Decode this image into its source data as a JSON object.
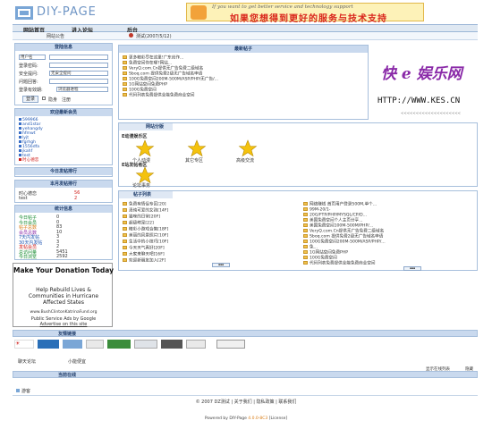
{
  "header": {
    "logo_text": "DIY-PAGE",
    "ad_line1": "If you want to get better service and technology support",
    "ad_line2": "如果您想得到更好的服务与技术支持"
  },
  "nav": {
    "items": [
      "网站首页",
      "进入论坛",
      "后台"
    ]
  },
  "subnav": {
    "notice_label": "网站公告",
    "notice_text": "测试(2007/5/12)"
  },
  "login": {
    "title": "登陆信息",
    "username_label": "用户名",
    "password_label": "登录密码:",
    "security_label": "安全提问:",
    "security_value": "无安全提问",
    "answer_label": "问题回答:",
    "expiry_label": "登录有效期:",
    "expiry_value": "浏览器进程",
    "login_button": "登录",
    "hide_label": "隐身",
    "register_label": "注册"
  },
  "welcome_members": {
    "title": "欢迎最新会员",
    "items": [
      "599966",
      "and1star",
      "yehangdy",
      "hfmwt",
      "lyjt",
      "fgrhgh",
      "1556dfa",
      "jkahf",
      "test",
      "时心德恋"
    ]
  },
  "today_rank": {
    "title": "今日发帖排行"
  },
  "month_rank": {
    "title": "本月发帖排行",
    "rows": [
      {
        "name": "时心德恋",
        "value": "56"
      },
      {
        "name": "test",
        "value": "2"
      }
    ]
  },
  "stats": {
    "title": "统计信息",
    "rows": [
      {
        "label": "今日帖子",
        "value": "0"
      },
      {
        "label": "今日会员",
        "value": "0"
      },
      {
        "label": "帖子总数",
        "value": "83"
      },
      {
        "label": "会员总数",
        "value": "10"
      },
      {
        "label": "7天内发帖",
        "value": "3"
      },
      {
        "label": "30天内发帖",
        "value": "3"
      },
      {
        "label": "发帖会员",
        "value": "2"
      },
      {
        "label": "总访问量",
        "value": "5451"
      },
      {
        "label": "今日浏览",
        "value": "2592"
      }
    ]
  },
  "donation": {
    "headline": "Make Your Donation Today",
    "line1": "Help Rebuild Lives &",
    "line2": "Communities in Hurricane",
    "line3": "Affected States",
    "url": "www.BushClintonKatrinaFund.org",
    "psa": "Public Service Ads by Google",
    "advertise": "Advertise on this site"
  },
  "newest_posts": {
    "title": "最新帖子",
    "items": [
      "更多精彩尽在这里!广东创作...",
      "免费空间你在哪?网站...",
      "VeryQ.com.Cn提供无广告免费二级域名",
      "Sboq.com 提供免费2级无广告域名申请",
      "100G免费空间200M-500M/ASP/PHP/无广告/...",
      "1G网站空间免费PHP",
      "100G免费空间",
      "代码列表免费提供全能免费商业空间"
    ]
  },
  "side_ad": {
    "brand": "快 e 娱乐网",
    "url": "HTTP://WWW.KES.CN",
    "dots": "<<<<<<<<<<<<<<<<<<<<"
  },
  "forum_sections": {
    "title": "网站分版",
    "group1": "E动漫娱乐区",
    "boards1": [
      "个人动漫",
      "其它专区",
      "高级交流"
    ],
    "group2": "E站发帖者区",
    "boards2": [
      "论坛事务"
    ]
  },
  "topic_list": {
    "title": "帖子列表",
    "left_items": [
      "免费有情侣专区[20]",
      "清纯可爱的女孩[14F]",
      "猫咪的日常[20F]",
      "超级萌宠[22]",
      "精彩小游戏合集[18F]",
      "美丽的风景照片[10F]",
      "生活中的小技巧[10F]",
      "今天天气真好[20F]",
      "大家来聊天吧[16F]",
      "欢迎新朋友加入[2F]"
    ],
    "right_items": [
      "网络赚钱 首页用户登录500M,单个...",
      "99M-20/1-",
      "20G/FTP/PHP/MYSQL/CP/D...",
      "美国免费空间个人主页分享...",
      "美国免费空间100M-500M/PHP/...",
      "VeryQ.com.Cn提供无广告免费二级域名",
      "Sboq.com 提供免费2级无广告域名申请",
      "100G免费空间200M-500M/ASP/PHP/...",
      "免...",
      "1G网站空间免费PHP",
      "100G免费空间",
      "代码列表免费提供全能免费商业空间"
    ]
  },
  "friend_links": {
    "title": "友情链接",
    "text_links": [
      "聊天论坛",
      "小能便宜"
    ],
    "site_footer_link": "显示在线列表",
    "hide_label": "隐藏"
  },
  "online": {
    "title": "当前在线",
    "member": "游客"
  },
  "footer": {
    "copyright": "© 2007 DZ测试",
    "links": [
      "关于我们",
      "隐私政策",
      "联系我们"
    ],
    "powered": "Powered by DIY-Page",
    "version": "4.0.0-8C3",
    "license": "License"
  },
  "colors": {
    "header_blue": "#6f95c5",
    "panel_border": "#a7bfdc",
    "panel_title_bg": "#c9d9ee",
    "ad_red": "#d9261c"
  }
}
